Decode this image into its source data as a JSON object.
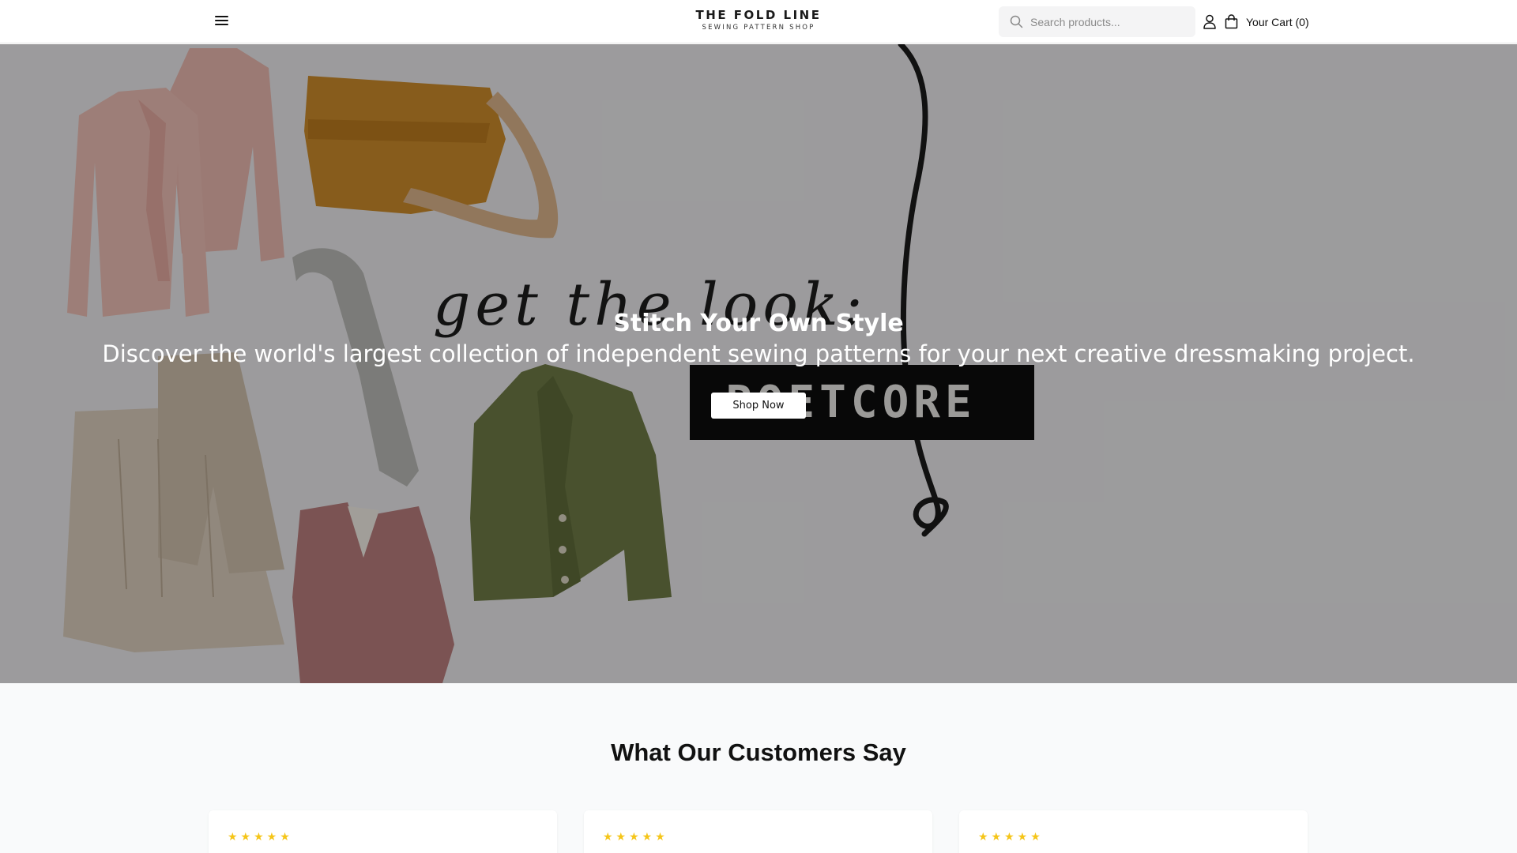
{
  "header": {
    "logo_main": "THE FOLD LINE",
    "logo_sub": "SEWING PATTERN SHOP",
    "search_placeholder": "Search products...",
    "cart_label": "Your Cart (0)",
    "icons": [
      "menu-icon",
      "search-icon",
      "user-icon",
      "shopping-bag-icon"
    ]
  },
  "hero": {
    "title": "Stitch Your Own Style",
    "subtitle": "Discover the world's largest collection of independent sewing patterns for your next creative dressmaking project.",
    "cta_label": "Shop Now",
    "image_text": {
      "script": "get the look:",
      "banner": "POETCORE"
    }
  },
  "testimonials": {
    "heading": "What Our Customers Say",
    "cards": [
      {
        "stars": "★★★★★"
      },
      {
        "stars": "★★★★★"
      },
      {
        "stars": "★★★★★"
      }
    ]
  },
  "colors": {
    "accent_star": "#f5c518",
    "hero_background": "#e9e8ea",
    "section_background": "#f9fafb"
  }
}
